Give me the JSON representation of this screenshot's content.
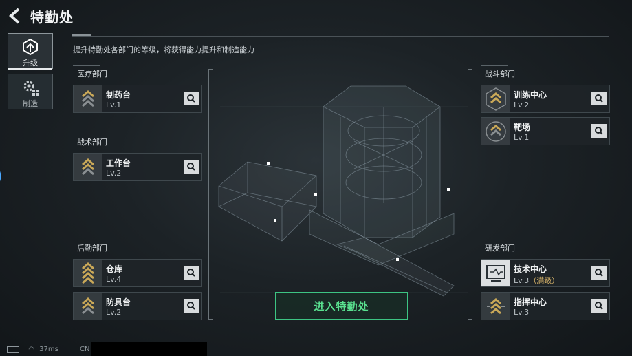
{
  "header": {
    "title": "特勤处"
  },
  "subtitle": "提升特勤处各部门的等级，将获得能力提升和制造能力",
  "tabs": [
    {
      "label": "升级",
      "icon": "upgrade-icon",
      "active": true
    },
    {
      "label": "制造",
      "icon": "gear-icon",
      "active": false
    }
  ],
  "departments": {
    "medical": {
      "title": "医疗部门",
      "rooms": [
        {
          "name": "制药台",
          "level": "Lv.1"
        }
      ]
    },
    "tactical": {
      "title": "战术部门",
      "rooms": [
        {
          "name": "工作台",
          "level": "Lv.2"
        }
      ]
    },
    "logistics": {
      "title": "后勤部门",
      "rooms": [
        {
          "name": "仓库",
          "level": "Lv.4"
        },
        {
          "name": "防具台",
          "level": "Lv.2"
        }
      ]
    },
    "combat": {
      "title": "战斗部门",
      "rooms": [
        {
          "name": "训练中心",
          "level": "Lv.2"
        },
        {
          "name": "靶场",
          "level": "Lv.1"
        }
      ]
    },
    "research": {
      "title": "研发部门",
      "rooms": [
        {
          "name": "技术中心",
          "level": "Lv.3",
          "level_note": "（满级）"
        },
        {
          "name": "指挥中心",
          "level": "Lv.3"
        }
      ]
    }
  },
  "enter_button": "进入特勤处",
  "status": {
    "ping": "37ms",
    "region": "CN U"
  },
  "colors": {
    "accent_green": "#3dc483",
    "max_level": "#d8b46a"
  }
}
